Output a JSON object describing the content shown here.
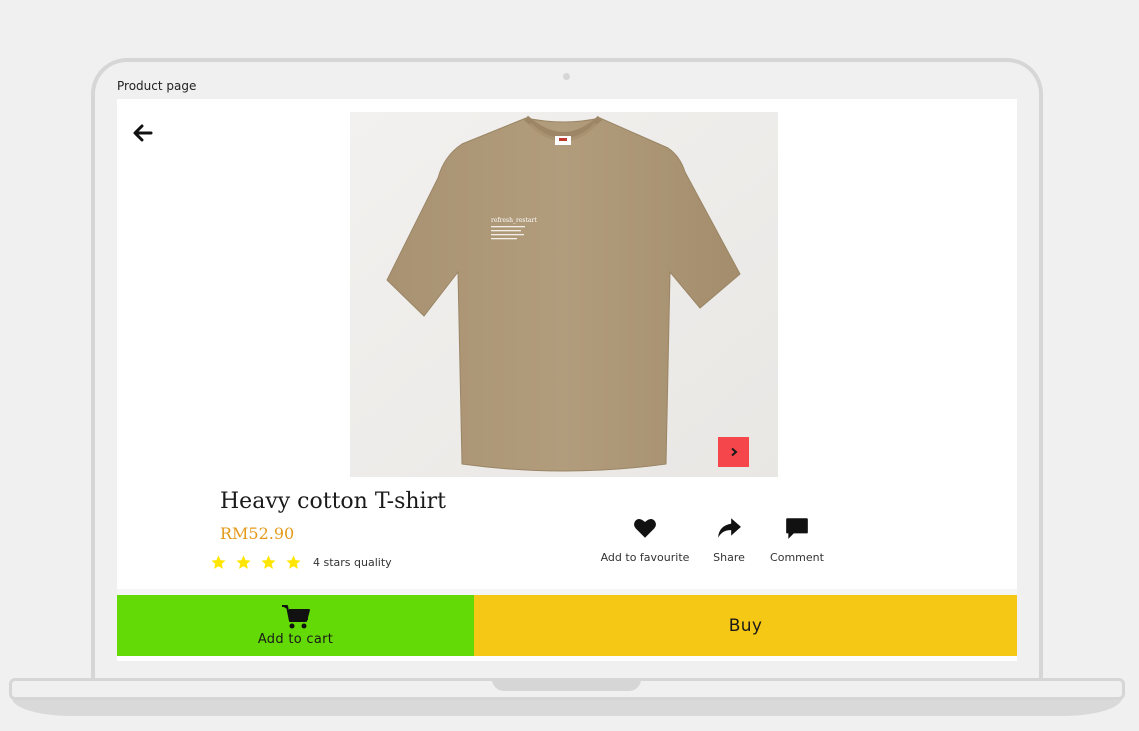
{
  "frame": {
    "title": "Product page"
  },
  "product": {
    "title": "Heavy cotton T-shirt",
    "price": "RM52.90",
    "rating": {
      "stars": 4,
      "max_stars": 5,
      "text": "4 stars quality"
    },
    "image": {
      "icon": "tshirt-image",
      "print_text": "refresh_restart"
    }
  },
  "icons": {
    "back": "arrow-left-icon",
    "next": "chevron-right-icon",
    "favourite": "heart-icon",
    "share": "share-icon",
    "comment": "comment-icon",
    "cart": "cart-icon",
    "star": "star-icon"
  },
  "actions": {
    "favourite_label": "Add to favourite",
    "share_label": "Share",
    "comment_label": "Comment"
  },
  "buttons": {
    "add_to_cart_label": "Add to cart",
    "buy_label": "Buy"
  },
  "colors": {
    "price": "#e39a1b",
    "star": "#ffe600",
    "next_button": "#f5474b",
    "add_to_cart": "#63d905",
    "buy": "#f6c816",
    "tshirt": "#ab9676"
  }
}
